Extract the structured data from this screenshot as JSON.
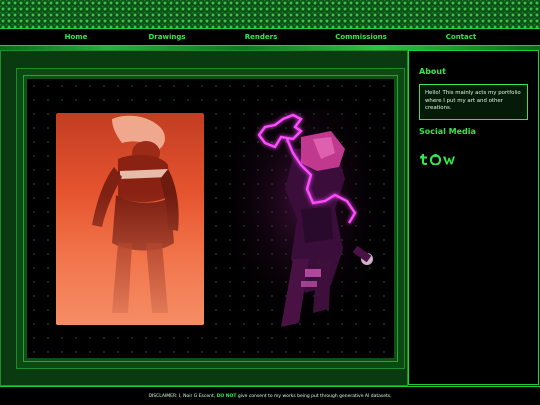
{
  "nav": {
    "items": [
      {
        "label": "Home"
      },
      {
        "label": "Drawings"
      },
      {
        "label": "Renders"
      },
      {
        "label": "Commissions"
      },
      {
        "label": "Contact"
      }
    ]
  },
  "sidebar": {
    "about": {
      "heading": "About",
      "text": "Hello! This mainly acts my portfolio where I put my art and other creations."
    },
    "social": {
      "heading": "Social Media",
      "icons": [
        "tumblr-icon",
        "toyhouse-icon",
        "twitter-icon"
      ]
    }
  },
  "footer": {
    "before": "DISCLAIMER: I, Noir G Escent,",
    "highlight": "DO NOT",
    "after": "give consent to my works being put through generative AI datasets."
  },
  "colors": {
    "accent": "#32e84a",
    "border": "#1fd136",
    "panel": "#0a3b10",
    "background": "#000000",
    "art_orange": "#e4522e",
    "neon_pink": "#ff3cff"
  }
}
